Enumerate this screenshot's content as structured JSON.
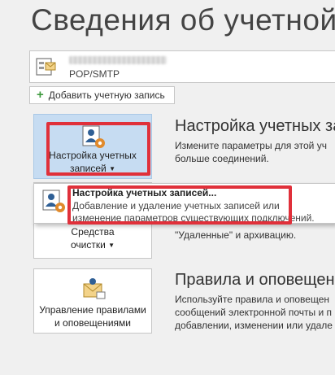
{
  "page": {
    "title": "Сведения об учетной"
  },
  "account": {
    "type": "POP/SMTP"
  },
  "add_account": {
    "label": "Добавить учетную запись"
  },
  "account_settings": {
    "tile_line1": "Настройка учетных",
    "tile_line2": "записей",
    "section_title": "Настройка учетных зап",
    "desc_line1": "Измените параметры для этой уч",
    "desc_line2": "больше соединений."
  },
  "dropdown": {
    "item_title": "Настройка учетных записей...",
    "item_desc_line1": "Добавление и удаление учетных записей или",
    "item_desc_line2": "изменение параметров существующих подключений."
  },
  "cleanup": {
    "tile_line1": "Средства",
    "tile_line2": "очистки",
    "desc_fragment": "\"Удаленные\" и архивацию."
  },
  "rules": {
    "tile_line1": "Управление правилами",
    "tile_line2": "и оповещениями",
    "section_title": "Правила и оповещени",
    "desc_line1": "Используйте правила и оповещен",
    "desc_line2": "сообщений электронной почты и п",
    "desc_line3": "добавлении, изменении или удале"
  },
  "colors": {
    "highlight_red": "#e0303a",
    "tile_selected": "#c6dcf2"
  }
}
